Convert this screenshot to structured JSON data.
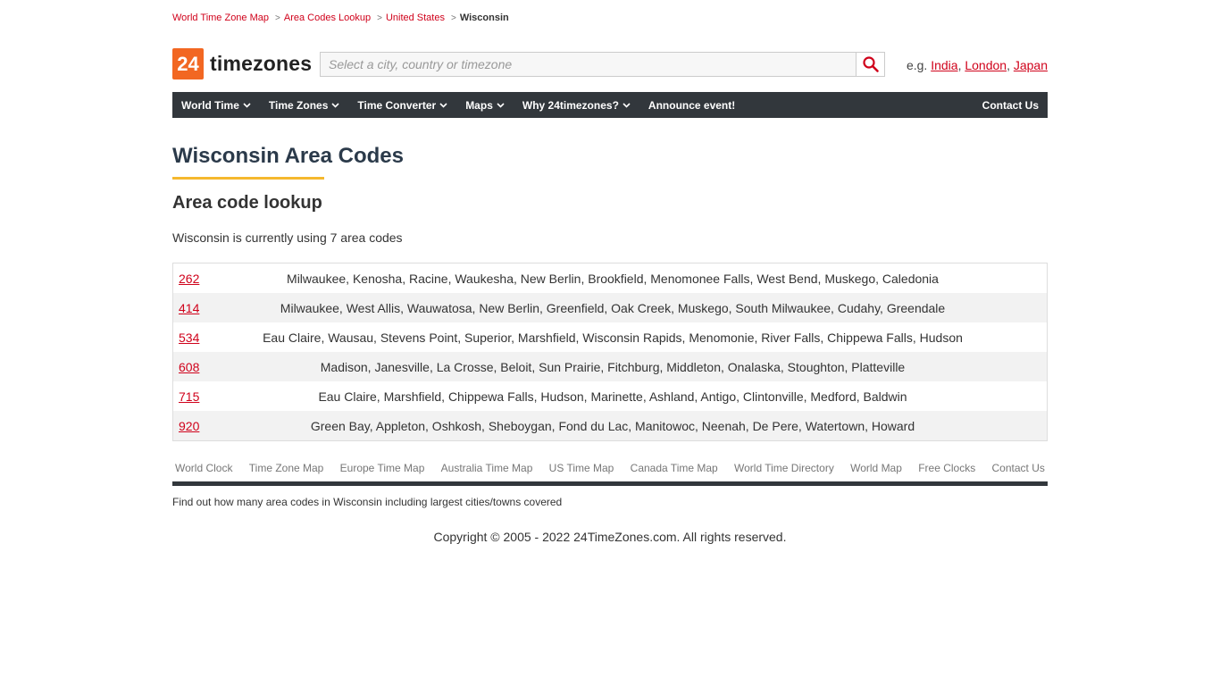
{
  "breadcrumb": [
    {
      "label": "World Time Zone Map"
    },
    {
      "label": "Area Codes Lookup"
    },
    {
      "label": "United States"
    }
  ],
  "breadcrumb_current": "Wisconsin",
  "logo": {
    "number": "24",
    "text": "timezones",
    "accent_color": "#f26722"
  },
  "search": {
    "placeholder": "Select a city, country or timezone",
    "value": "",
    "icon": "search-icon"
  },
  "examples": {
    "prefix": "e.g.",
    "links": [
      "India",
      "London",
      "Japan"
    ]
  },
  "nav": {
    "items": [
      "World Time",
      "Time Zones",
      "Time Converter",
      "Maps",
      "Why 24timezones?"
    ],
    "announce": "Announce event!",
    "contact": "Contact Us"
  },
  "page": {
    "title": "Wisconsin Area Codes",
    "subtitle": "Area code lookup",
    "intro": "Wisconsin is currently using 7 area codes"
  },
  "area_codes": [
    {
      "code": "262",
      "cities": "Milwaukee, Kenosha, Racine, Waukesha, New Berlin, Brookfield, Menomonee Falls, West Bend, Muskego, Caledonia"
    },
    {
      "code": "414",
      "cities": "Milwaukee, West Allis, Wauwatosa, New Berlin, Greenfield, Oak Creek, Muskego, South Milwaukee, Cudahy, Greendale"
    },
    {
      "code": "534",
      "cities": "Eau Claire, Wausau, Stevens Point, Superior, Marshfield, Wisconsin Rapids, Menomonie, River Falls, Chippewa Falls, Hudson"
    },
    {
      "code": "608",
      "cities": "Madison, Janesville, La Crosse, Beloit, Sun Prairie, Fitchburg, Middleton, Onalaska, Stoughton, Platteville"
    },
    {
      "code": "715",
      "cities": "Eau Claire, Marshfield, Chippewa Falls, Hudson, Marinette, Ashland, Antigo, Clintonville, Medford, Baldwin"
    },
    {
      "code": "920",
      "cities": "Green Bay, Appleton, Oshkosh, Sheboygan, Fond du Lac, Manitowoc, Neenah, De Pere, Watertown, Howard"
    }
  ],
  "footer": {
    "links": [
      "World Clock",
      "Time Zone Map",
      "Europe Time Map",
      "Australia Time Map",
      "US Time Map",
      "Canada Time Map",
      "World Time Directory",
      "World Map",
      "Free Clocks",
      "Contact Us"
    ],
    "description": "Find out how many area codes in Wisconsin including largest cities/towns covered",
    "copyright": "Copyright © 2005 - 2022 24TimeZones.com. All rights reserved."
  },
  "colors": {
    "link": "#d0021b",
    "nav_bg": "#32373c",
    "title": "#2b3a4a",
    "underline": "#f5b82e"
  }
}
